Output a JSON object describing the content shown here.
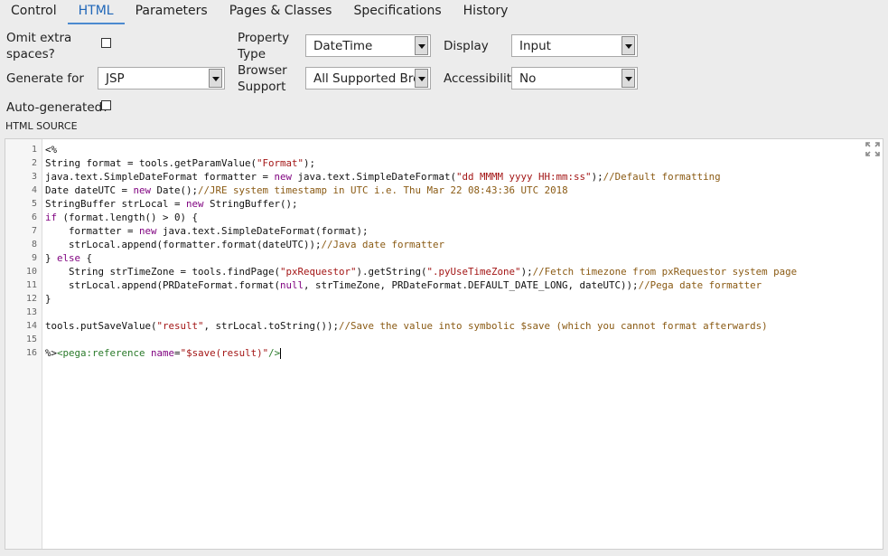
{
  "tabs": [
    "Control",
    "HTML",
    "Parameters",
    "Pages & Classes",
    "Specifications",
    "History"
  ],
  "active_tab": "HTML",
  "form": {
    "omit_label_1": "Omit extra",
    "omit_label_2": "spaces?",
    "omit_checked": false,
    "generate_for_label": "Generate for",
    "generate_for_value": "JSP",
    "autogen_label": "Auto-generated?",
    "autogen_checked": false,
    "property_type_label_1": "Property",
    "property_type_label_2": "Type",
    "property_type_value": "DateTime",
    "browser_support_label_1": "Browser",
    "browser_support_label_2": "Support",
    "browser_support_value": "All Supported Brow",
    "display_label": "Display",
    "display_value": "Input",
    "accessibility_label": "Accessibility",
    "accessibility_value": "No"
  },
  "html_source_label": "HTML SOURCE",
  "code": {
    "line_numbers": [
      "1",
      "2",
      "3",
      "4",
      "5",
      "6",
      "7",
      "8",
      "9",
      "10",
      "11",
      "12",
      "13",
      "14",
      "15",
      "16"
    ],
    "l1": "<%",
    "l2a": "String format = tools.getParamValue(",
    "l2b": "\"Format\"",
    "l2c": ");",
    "l3a": "java.text.SimpleDateFormat formatter = ",
    "l3b": "new",
    "l3c": " java.text.SimpleDateFormat(",
    "l3d": "\"dd MMMM yyyy HH:mm:ss\"",
    "l3e": ");",
    "l3f": "//Default formatting",
    "l4a": "Date dateUTC = ",
    "l4b": "new",
    "l4c": " Date();",
    "l4d": "//JRE system timestamp in UTC i.e. Thu Mar 22 08:43:36 UTC 2018",
    "l5a": "StringBuffer strLocal = ",
    "l5b": "new",
    "l5c": " StringBuffer();",
    "l6a": "if",
    "l6b": " (format.length() > 0) {",
    "l7a": "    formatter = ",
    "l7b": "new",
    "l7c": " java.text.SimpleDateFormat(format);",
    "l8a": "    strLocal.append(formatter.format(dateUTC));",
    "l8b": "//Java date formatter",
    "l9a": "} ",
    "l9b": "else",
    "l9c": " {",
    "l10a": "    String strTimeZone = tools.findPage(",
    "l10b": "\"pxRequestor\"",
    "l10c": ").getString(",
    "l10d": "\".pyUseTimeZone\"",
    "l10e": ");",
    "l10f": "//Fetch timezone from pxRequestor system page",
    "l11a": "    strLocal.append(PRDateFormat.format(",
    "l11b": "null",
    "l11c": ", strTimeZone, PRDateFormat.DEFAULT_DATE_LONG, dateUTC));",
    "l11d": "//Pega date formatter",
    "l12": "}",
    "l14a": "tools.putSaveValue(",
    "l14b": "\"result\"",
    "l14c": ", strLocal.toString());",
    "l14d": "//Save the value into symbolic $save (which you cannot format afterwards)",
    "l16a": "%>",
    "l16b": "<pega:reference",
    "l16c": " name",
    "l16d": "=",
    "l16e": "\"$save(result)\"",
    "l16f": "/>"
  },
  "icons": {
    "expand": "expand-icon",
    "dropdown": "chevron-down-icon"
  }
}
